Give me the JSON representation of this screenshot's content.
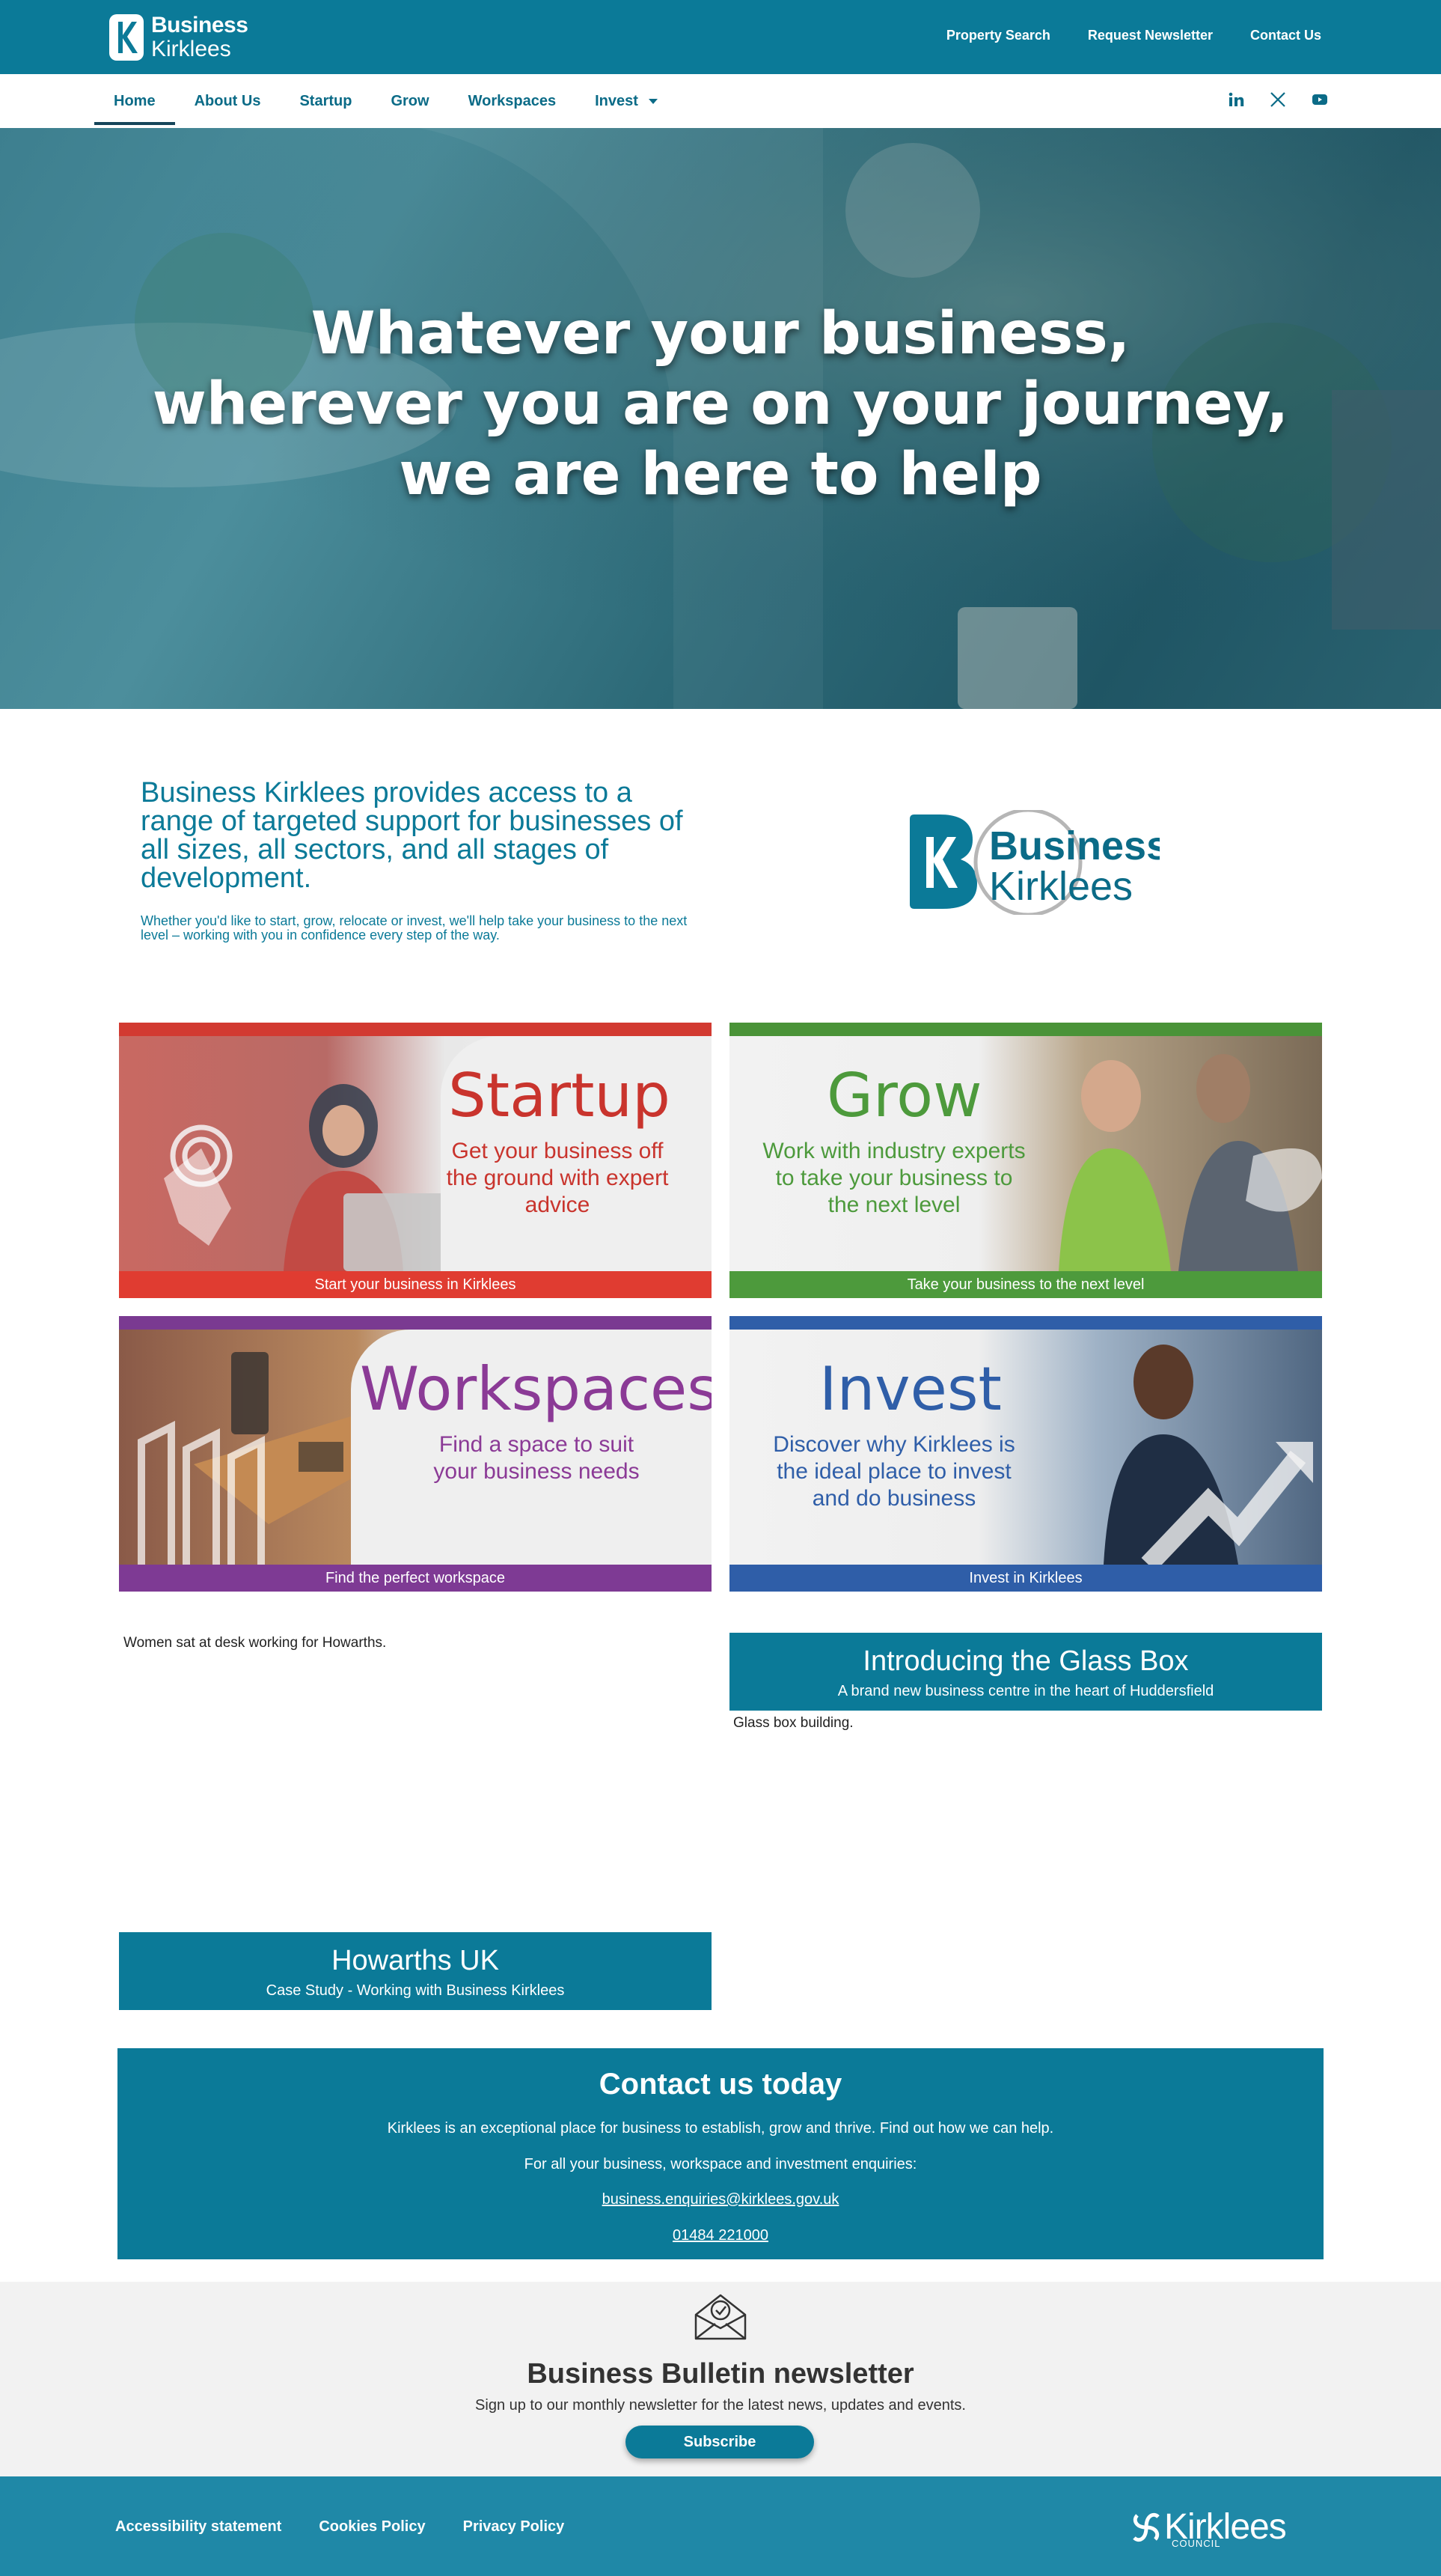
{
  "header": {
    "logo_line1": "Business",
    "logo_line2": "Kirklees",
    "links": [
      "Property Search",
      "Request Newsletter",
      "Contact Us"
    ]
  },
  "nav": {
    "items": [
      "Home",
      "About Us",
      "Startup",
      "Grow",
      "Workspaces",
      "Invest"
    ],
    "active": "Home",
    "social": [
      "linkedin-icon",
      "x-icon",
      "youtube-icon"
    ]
  },
  "hero": {
    "line1": "Whatever your business,",
    "line2": "wherever you are on your journey,",
    "line3": "we are here to help"
  },
  "intro": {
    "heading": "Business Kirklees provides access to a range of targeted support for businesses of all sizes, all sectors, and all stages of development.",
    "sub": "Whether you'd like to start, grow, relocate or invest, we'll help take your business to the next level – working with you in confidence every step of the way.",
    "logo_line1": "Business",
    "logo_line2": "Kirklees"
  },
  "tiles": [
    {
      "title": "Startup",
      "desc": "Get your business off the ground with expert advice",
      "bar": "Start your business in Kirklees",
      "color": "#e03c31"
    },
    {
      "title": "Grow",
      "desc": "Work with industry experts to take your business to the next level",
      "bar": "Take your business to the next level",
      "color": "#4d9a3c"
    },
    {
      "title": "Workspaces",
      "desc": "Find a space to suit your business needs",
      "bar": "Find the perfect workspace",
      "color": "#7e3a94"
    },
    {
      "title": "Invest",
      "desc": "Discover why Kirklees is the ideal place to invest and do business",
      "bar": "Invest in Kirklees",
      "color": "#2f5ea8"
    }
  ],
  "features": {
    "howarths_alt": "Women sat at desk working for Howarths.",
    "glassbox_alt": "Glass box building.",
    "glassbox_title": "Introducing the Glass Box",
    "glassbox_sub": "A brand new business centre in the heart of Huddersfield",
    "howarths_title": "Howarths UK",
    "howarths_sub": "Case Study - Working with Business Kirklees"
  },
  "contact": {
    "title": "Contact us today",
    "text1": "Kirklees is an exceptional place for business to establish, grow and thrive. Find out how we can help.",
    "text2": "For all your business, workspace and investment enquiries:",
    "email": "business.enquiries@kirklees.gov.uk",
    "phone": "01484 221000"
  },
  "newsletter": {
    "title": "Business Bulletin newsletter",
    "text": "Sign up to our monthly newsletter for the latest news, updates and events.",
    "button": "Subscribe"
  },
  "footer": {
    "links": [
      "Accessibility statement",
      "Cookies Policy",
      "Privacy Policy"
    ],
    "logo": "Kirklees",
    "logo_sub": "COUNCIL"
  },
  "colors": {
    "brand": "#0b7a98",
    "footer": "#1f88a7",
    "startup": "#e03c31",
    "grow": "#4d9a3c",
    "workspaces": "#7e3a94",
    "invest": "#2f5ea8"
  }
}
